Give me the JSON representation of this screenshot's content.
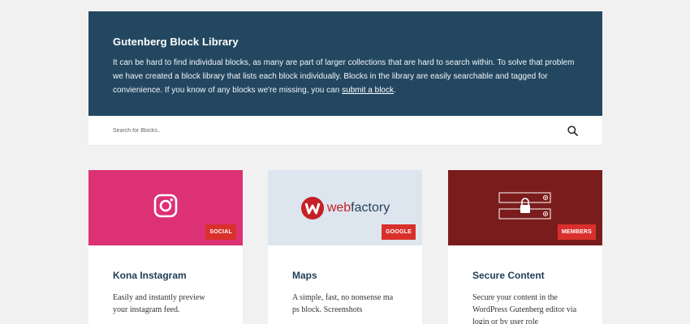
{
  "hero": {
    "title": "Gutenberg Block Library",
    "description": "It can be hard to find individual blocks, as many are part of larger collections that are hard to search within. To solve that problem we have created a block library that lists each block individually. Blocks in the library are easily searchable and tagged for convienience. If you know of any blocks we're missing, you can ",
    "link_text": "submit a block",
    "period": "."
  },
  "search": {
    "placeholder": "Search for Blocks..",
    "icon": "search-icon"
  },
  "cards": [
    {
      "title": "Kona Instagram",
      "tag": "SOCIAL",
      "description": "Easily and instantly preview your instagram feed.",
      "icon": "instagram-icon",
      "color": "#dc3175"
    },
    {
      "title": "Maps",
      "tag": "GOOGLE",
      "description": "A simple, fast, no nonsense ma ps block. Screenshots",
      "logo_prefix": "web",
      "logo_suffix": "factory",
      "color": "#dde6ee"
    },
    {
      "title": "Secure Content",
      "tag": "MEMBERS",
      "description": "Secure your content in the WordPress Gutenberg editor via login or by user role",
      "icon": "lock-form-icon",
      "color": "#7b1c1c"
    }
  ],
  "colors": {
    "hero_bg": "#234760",
    "tag_bg": "#d9302c",
    "page_bg": "#f1f1f1"
  }
}
